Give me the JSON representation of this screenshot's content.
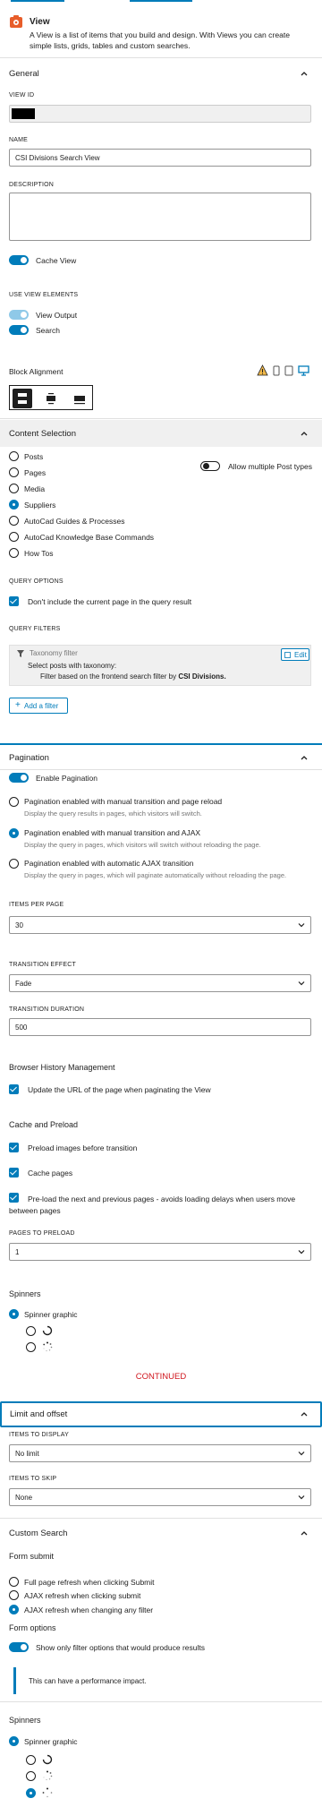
{
  "block": {
    "title": "View",
    "description": "A View is a list of items that you build and design. With Views you can create simple lists, grids, tables and custom searches.",
    "icon": "view-block-icon"
  },
  "general": {
    "heading": "General",
    "view_id_label": "VIEW ID",
    "name_label": "NAME",
    "name_value": "CSI Divisions Search View",
    "description_label": "DESCRIPTION",
    "description_value": "",
    "cache_view": "Cache View",
    "use_view_elements": "USE VIEW ELEMENTS",
    "view_output": "View Output",
    "search": "Search",
    "block_alignment": "Block Alignment"
  },
  "content_selection": {
    "heading": "Content Selection",
    "post_types": [
      "Posts",
      "Pages",
      "Media",
      "Suppliers",
      "AutoCad Guides & Processes",
      "AutoCad Knowledge Base Commands",
      "How Tos"
    ],
    "selected": "Suppliers",
    "allow_multiple": "Allow multiple Post types",
    "query_options_label": "QUERY OPTIONS",
    "dont_include_current": "Don't include the current page in the query result",
    "query_filters_label": "QUERY FILTERS",
    "filter_title": "Taxonomy filter",
    "filter_edit": "Edit",
    "filter_line1": "Select posts with taxonomy:",
    "filter_line2_prefix": "Filter based on the frontend search filter by ",
    "filter_line2_bold": "CSI Divisions.",
    "add_filter": "Add a filter"
  },
  "pagination": {
    "heading": "Pagination",
    "enable": "Enable Pagination",
    "options": [
      {
        "label": "Pagination enabled with manual transition and page reload",
        "desc": "Display the query results in pages, which visitors will switch."
      },
      {
        "label": "Pagination enabled with manual transition and AJAX",
        "desc": "Display the query in pages, which visitors will switch without reloading the page."
      },
      {
        "label": "Pagination enabled with automatic AJAX transition",
        "desc": "Display the query in pages, which will paginate automatically without reloading the page."
      }
    ],
    "selected_index": 1,
    "items_per_page_label": "ITEMS PER PAGE",
    "items_per_page": "30",
    "transition_effect_label": "TRANSITION EFFECT",
    "transition_effect": "Fade",
    "transition_duration_label": "TRANSITION DURATION",
    "transition_duration": "500",
    "browser_history": "Browser History Management",
    "update_url": "Update the URL of the page when paginating the View",
    "cache_preload": "Cache and Preload",
    "preload_images": "Preload images before transition",
    "cache_pages": "Cache pages",
    "preload_next_prev": "Pre-load the next and previous pages - avoids loading delays when users move between pages",
    "pages_to_preload_label": "PAGES TO PRELOAD",
    "pages_to_preload": "1",
    "spinners": "Spinners",
    "spinner_graphic": "Spinner graphic"
  },
  "continued": "CONTINUED",
  "limit_offset": {
    "heading": "Limit and offset",
    "items_to_display_label": "ITEMS TO DISPLAY",
    "items_to_display": "No limit",
    "items_to_skip_label": "ITEMS TO SKIP",
    "items_to_skip": "None"
  },
  "custom_search": {
    "heading": "Custom Search",
    "form_submit": "Form submit",
    "submit_options": [
      "Full page refresh when clicking Submit",
      "AJAX refresh when clicking submit",
      "AJAX refresh when changing any filter"
    ],
    "selected_index": 2,
    "form_options": "Form options",
    "show_only_filter": "Show only filter options that would produce results",
    "notice": "This can have a performance impact.",
    "spinners": "Spinners",
    "spinner_graphic": "Spinner graphic"
  },
  "colors": {
    "accent": "#007cba",
    "warning": "#f0b849"
  }
}
